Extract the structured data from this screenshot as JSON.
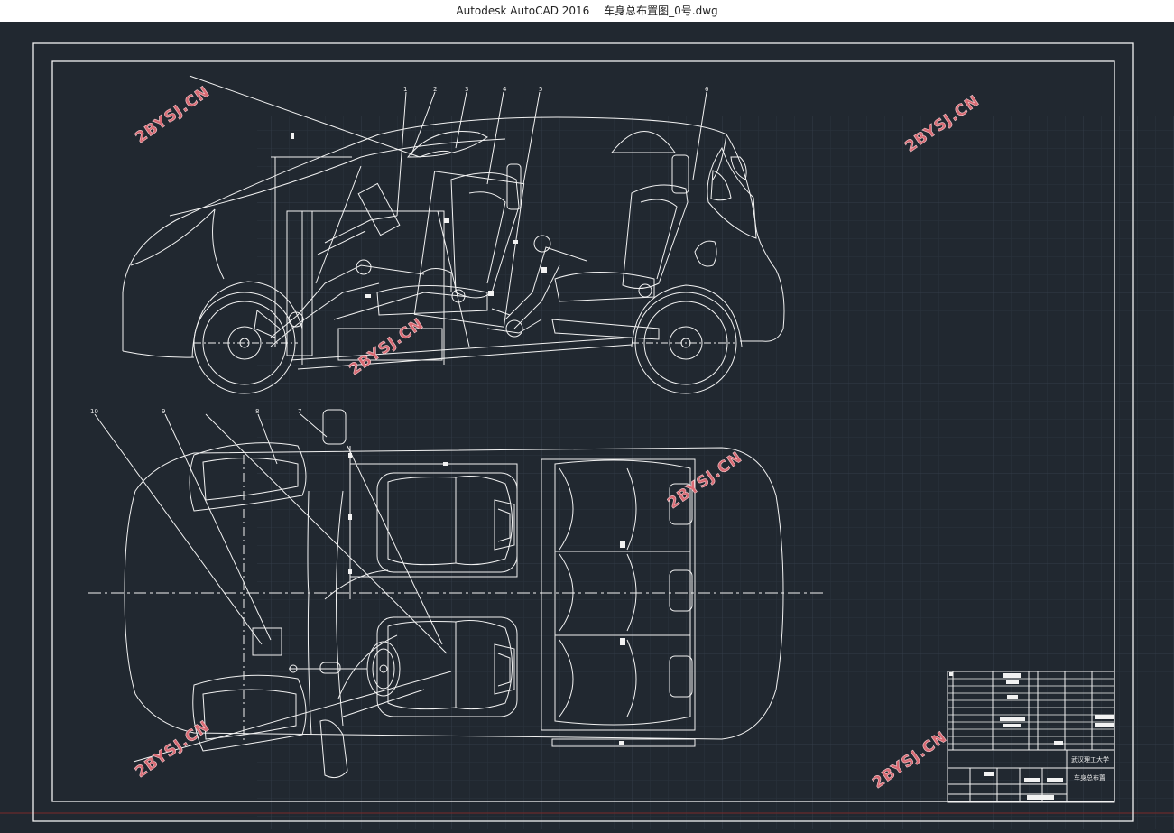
{
  "window": {
    "app_title": "Autodesk AutoCAD 2016",
    "file_name": "车身总布置图_0号.dwg"
  },
  "theme": {
    "background": "#212830",
    "grid_color": "#2c3440",
    "line_color": "#f2f2f2",
    "watermark_color": "#d86a73"
  },
  "watermark": {
    "text": "2BYSJ.CN"
  },
  "callouts": {
    "side_view": [
      "1",
      "2",
      "3",
      "4",
      "5",
      "6"
    ],
    "top_view": [
      "10",
      "9",
      "8",
      "7"
    ]
  },
  "title_block": {
    "school": "武汉理工大学",
    "drawing_title": "车身总布置"
  }
}
